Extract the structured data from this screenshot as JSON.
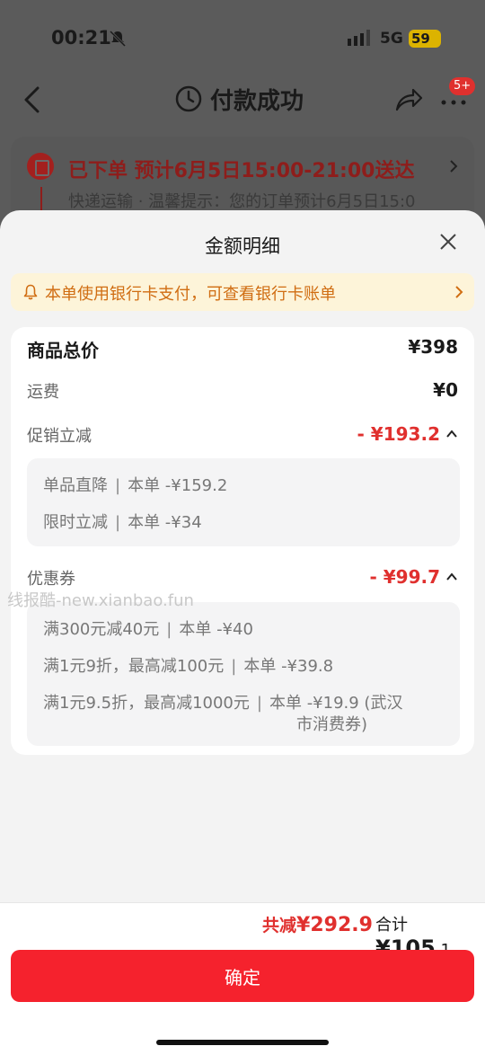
{
  "status": {
    "time": "00:21",
    "network": "5G",
    "battery": "59"
  },
  "nav": {
    "title": "付款成功",
    "badge": "5+"
  },
  "delivery": {
    "title": "已下单 预计6月5日15:00-21:00送达",
    "subtitle": "快递运输 · 温馨提示：您的订单预计6月5日15:0"
  },
  "sheet": {
    "title": "金额明细",
    "notice": "本单使用银行卡支付，可查看银行卡账单",
    "goods": {
      "label": "商品总价",
      "value": "¥398"
    },
    "shipping": {
      "label": "运费",
      "value": "¥0"
    },
    "promo": {
      "label": "促销立减",
      "value": "- ¥193.2",
      "items": [
        {
          "text": "单品直降",
          "sep": "|",
          "detail": "本单 -¥159.2"
        },
        {
          "text": "限时立减",
          "sep": "|",
          "detail": "本单 -¥34"
        }
      ]
    },
    "coupon": {
      "label": "优惠券",
      "value": "- ¥99.7",
      "items": [
        {
          "text": "满300元减40元",
          "sep": "|",
          "detail": "本单 -¥40"
        },
        {
          "text": "满1元9折，最高减100元",
          "sep": "|",
          "detail": "本单 -¥39.8"
        },
        {
          "text": "满1元9.5折，最高减1000元",
          "sep": "|",
          "detail": "本单 -¥19.9 (武汉",
          "detail2": "市消费券)"
        }
      ]
    },
    "watermark": "线报酷-new.xianbao.fun"
  },
  "footer": {
    "reduce_label": "共减",
    "reduce_value": "¥292.9",
    "total_label": "合计",
    "total_value": "¥105",
    "total_decimal": ".1",
    "confirm": "确定"
  }
}
